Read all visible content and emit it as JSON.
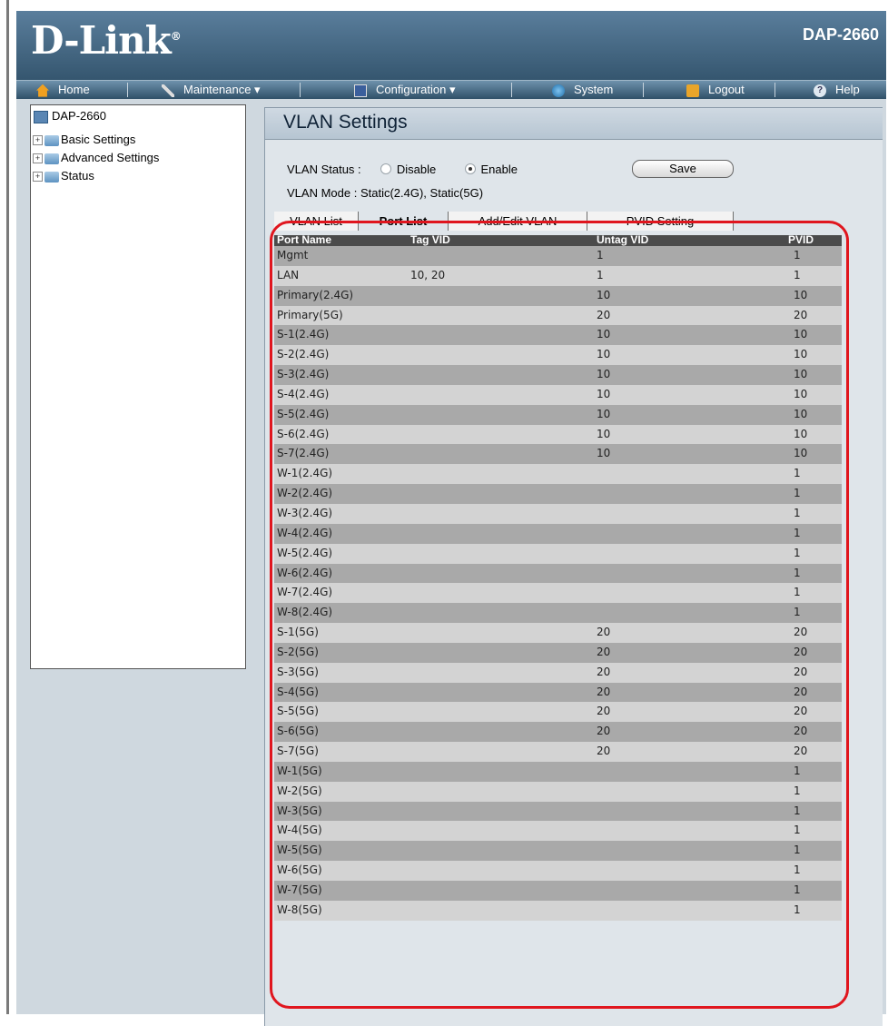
{
  "header": {
    "brand": "D-Link",
    "model": "DAP-2660"
  },
  "menu": [
    {
      "label": "Home",
      "icon": "home-icon"
    },
    {
      "label": "Maintenance ▾",
      "icon": "tools-icon"
    },
    {
      "label": "Configuration ▾",
      "icon": "save-disk-icon"
    },
    {
      "label": "System",
      "icon": "system-icon"
    },
    {
      "label": "Logout",
      "icon": "key-icon"
    },
    {
      "label": "Help",
      "icon": "help-icon"
    }
  ],
  "sidebar": {
    "root": "DAP-2660",
    "items": [
      {
        "label": "Basic Settings",
        "expander": "+"
      },
      {
        "label": "Advanced Settings",
        "expander": "+"
      },
      {
        "label": "Status",
        "expander": "+"
      }
    ]
  },
  "panel": {
    "title": "VLAN Settings",
    "status_label": "VLAN Status :",
    "disable_label": "Disable",
    "enable_label": "Enable",
    "status_value": "Enable",
    "save_label": "Save",
    "mode_label": "VLAN Mode :",
    "mode_value": "Static(2.4G),  Static(5G)"
  },
  "tabs": [
    {
      "label": "VLAN List",
      "active": false
    },
    {
      "label": "Port List",
      "active": true
    },
    {
      "label": "Add/Edit VLAN",
      "active": false
    },
    {
      "label": "PVID Setting",
      "active": false
    }
  ],
  "table": {
    "columns": [
      "Port Name",
      "Tag VID",
      "Untag VID",
      "PVID"
    ],
    "rows": [
      [
        "Mgmt",
        "",
        "1",
        "1"
      ],
      [
        "LAN",
        "10, 20",
        "1",
        "1"
      ],
      [
        "Primary(2.4G)",
        "",
        "10",
        "10"
      ],
      [
        "Primary(5G)",
        "",
        "20",
        "20"
      ],
      [
        "S-1(2.4G)",
        "",
        "10",
        "10"
      ],
      [
        "S-2(2.4G)",
        "",
        "10",
        "10"
      ],
      [
        "S-3(2.4G)",
        "",
        "10",
        "10"
      ],
      [
        "S-4(2.4G)",
        "",
        "10",
        "10"
      ],
      [
        "S-5(2.4G)",
        "",
        "10",
        "10"
      ],
      [
        "S-6(2.4G)",
        "",
        "10",
        "10"
      ],
      [
        "S-7(2.4G)",
        "",
        "10",
        "10"
      ],
      [
        "W-1(2.4G)",
        "",
        "",
        "1"
      ],
      [
        "W-2(2.4G)",
        "",
        "",
        "1"
      ],
      [
        "W-3(2.4G)",
        "",
        "",
        "1"
      ],
      [
        "W-4(2.4G)",
        "",
        "",
        "1"
      ],
      [
        "W-5(2.4G)",
        "",
        "",
        "1"
      ],
      [
        "W-6(2.4G)",
        "",
        "",
        "1"
      ],
      [
        "W-7(2.4G)",
        "",
        "",
        "1"
      ],
      [
        "W-8(2.4G)",
        "",
        "",
        "1"
      ],
      [
        "S-1(5G)",
        "",
        "20",
        "20"
      ],
      [
        "S-2(5G)",
        "",
        "20",
        "20"
      ],
      [
        "S-3(5G)",
        "",
        "20",
        "20"
      ],
      [
        "S-4(5G)",
        "",
        "20",
        "20"
      ],
      [
        "S-5(5G)",
        "",
        "20",
        "20"
      ],
      [
        "S-6(5G)",
        "",
        "20",
        "20"
      ],
      [
        "S-7(5G)",
        "",
        "20",
        "20"
      ],
      [
        "W-1(5G)",
        "",
        "",
        "1"
      ],
      [
        "W-2(5G)",
        "",
        "",
        "1"
      ],
      [
        "W-3(5G)",
        "",
        "",
        "1"
      ],
      [
        "W-4(5G)",
        "",
        "",
        "1"
      ],
      [
        "W-5(5G)",
        "",
        "",
        "1"
      ],
      [
        "W-6(5G)",
        "",
        "",
        "1"
      ],
      [
        "W-7(5G)",
        "",
        "",
        "1"
      ],
      [
        "W-8(5G)",
        "",
        "",
        "1"
      ]
    ]
  },
  "colors": {
    "header_bg": "#35566f",
    "highlight": "#e0161e",
    "row_odd": "#a9a9a9",
    "row_even": "#d3d3d3"
  }
}
